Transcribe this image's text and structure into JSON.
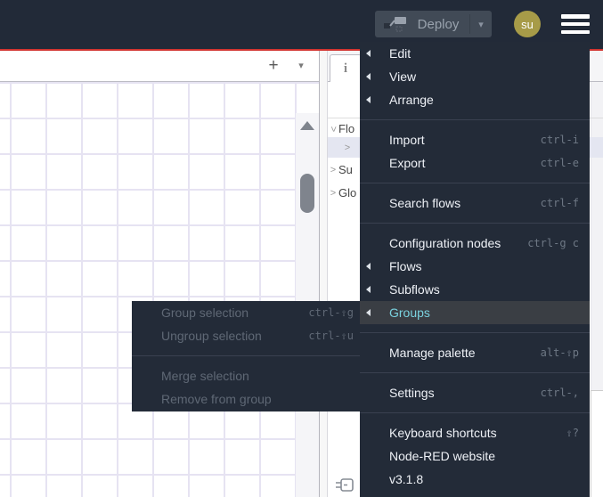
{
  "header": {
    "deploy_label": "Deploy",
    "avatar_initials": "su"
  },
  "icons": {
    "caret_down": "▾",
    "plus": "+",
    "chevron_right": ">",
    "info": "i",
    "secondary_tab": "i"
  },
  "canvas": {
    "tab_add": "+",
    "tab_caret": "▾"
  },
  "sidebar": {
    "outline_rows": [
      {
        "chevron": "down",
        "label": "Flo",
        "selected": false
      },
      {
        "chevron": "right",
        "label": "",
        "selected": true
      },
      {
        "chevron": "right",
        "label": "Su",
        "selected": false
      },
      {
        "chevron": "right",
        "label": "Glo",
        "selected": false
      }
    ]
  },
  "menu": {
    "items": [
      {
        "label": "Edit",
        "has_submenu": true
      },
      {
        "label": "View",
        "has_submenu": true
      },
      {
        "label": "Arrange",
        "has_submenu": true
      },
      {
        "separator": true
      },
      {
        "label": "Import",
        "shortcut": "ctrl-i"
      },
      {
        "label": "Export",
        "shortcut": "ctrl-e"
      },
      {
        "separator": true
      },
      {
        "label": "Search flows",
        "shortcut": "ctrl-f"
      },
      {
        "separator": true
      },
      {
        "label": "Configuration nodes",
        "shortcut": "ctrl-g c"
      },
      {
        "label": "Flows",
        "has_submenu": true
      },
      {
        "label": "Subflows",
        "has_submenu": true
      },
      {
        "label": "Groups",
        "has_submenu": true,
        "active": true
      },
      {
        "separator": true
      },
      {
        "label": "Manage palette",
        "shortcut": "alt-⇧p"
      },
      {
        "separator": true
      },
      {
        "label": "Settings",
        "shortcut": "ctrl-,"
      },
      {
        "separator": true
      },
      {
        "label": "Keyboard shortcuts",
        "shortcut": "⇧?"
      },
      {
        "label": "Node-RED website"
      },
      {
        "label": "v3.1.8"
      }
    ]
  },
  "submenu": {
    "items": [
      {
        "label": "Group selection",
        "shortcut": "ctrl-⇧g",
        "disabled": true
      },
      {
        "label": "Ungroup selection",
        "shortcut": "ctrl-⇧u",
        "disabled": true
      },
      {
        "separator": true
      },
      {
        "label": "Merge selection",
        "disabled": true
      },
      {
        "label": "Remove from group",
        "disabled": true
      }
    ]
  },
  "colors": {
    "header_bg": "#222a38",
    "header_red_line": "#d23430",
    "menu_bg": "#232b38",
    "menu_active_text": "#7ad2df",
    "avatar_bg": "#a79b48",
    "grid_line": "#e6e3f2"
  }
}
